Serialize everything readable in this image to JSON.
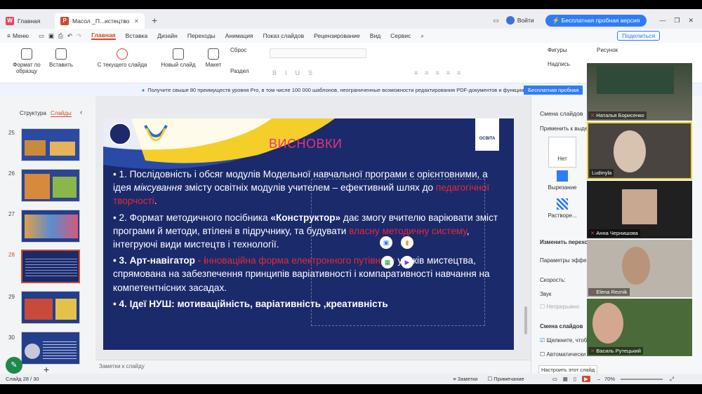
{
  "titlebar": {
    "home_tab": "Главная",
    "doc_tab": "Масол _П...истецтво",
    "add_tab": "+",
    "login": "Войти",
    "trial": "Бесплатная пробная версия"
  },
  "menubar": {
    "menu": "Меню",
    "items": [
      "Главная",
      "Вставка",
      "Дизайн",
      "Переходы",
      "Анимация",
      "Показ слайдов",
      "Рецензирование",
      "Вид",
      "Сервис"
    ],
    "share": "Поделиться"
  },
  "ribbon": {
    "format": "Формат по образцу",
    "insert": "Вставить",
    "from_current": "С текущего слайда",
    "new_slide": "Новый слайд",
    "layout": "Макет",
    "reset": "Сброс",
    "section": "Раздел",
    "shapes": "Фигуры",
    "picture": "Рисунок",
    "caption": "Надпись"
  },
  "promo": {
    "text": "Получите свыше 80 преимуществ уровня Pro, в том числе 100 000 шаблонов, неограниченные возможности редактирования PDF-документов и функции на основе ИИ.",
    "button": "Бесплатная пробная"
  },
  "leftpane": {
    "tab_structure": "Структура",
    "tab_slides": "Слайды",
    "slide_numbers": [
      "25",
      "26",
      "27",
      "28",
      "29",
      "30"
    ]
  },
  "slide": {
    "title": "ВИСНОВКИ",
    "logo_text": "ОСВІТА",
    "p1_a": "• 1. Послідовність і обсяг модулів Модельної навчальної програми є орієнтовними, а ідея ",
    "p1_b": "міксування",
    "p1_c": " змісту освітніх модулів учителем – ефективний шлях до ",
    "p1_d": "педагогічної творчості",
    "p1_e": ".",
    "p2_a": "• 2. Формат методичного посібника ",
    "p2_b": "«Конструктор»",
    "p2_c": " дає змогу вчителю варіювати зміст програми й методи, втілені в підручнику, та будувати ",
    "p2_d": "власну методичну систему",
    "p2_e": ", інтегруючі види мистецтв і технології.",
    "p3_a": "• 3. Арт-навігатор",
    "p3_b": " - і",
    "p3_c": "нноваційна форма електронного путівнику",
    "p3_d": " уроків мистецтва, спрямована на забезпечення принципів варіативності і компаративності навчання на компетентнісних засадах.",
    "p4": "• 4. Ідеї НУШ: мотиваційність, варіативність ,креативність"
  },
  "notes_placeholder": "Заметки к слайду",
  "rightpane": {
    "title": "Смена слайдов",
    "apply": "Применить к выдел",
    "none": "Нет",
    "cut": "Вырезание",
    "dissolve": "Растворе...",
    "modify": "Изменить переход",
    "params": "Параметры эффект",
    "speed": "Скорость:",
    "sound": "Звук",
    "loop": "Непрерывно",
    "change": "Смена слайдов",
    "on_click": "Щелкните, чтоб",
    "auto": "Автоматически",
    "apply_all": "Настроить этот слайд"
  },
  "status": {
    "slide": "Слайд 28 / 30",
    "notes": "Заметки",
    "comment": "Примечание",
    "zoom": "70%"
  },
  "participants": [
    "Наталья Борисенко",
    "Ludmyla",
    "Анна Чернишова",
    "Elena Reznik",
    "Василь Рутецький"
  ],
  "colors": {
    "accent": "#d04a2a",
    "slide_bg": "#1b2a6b",
    "title_pink": "#e8337a",
    "highlight_red": "#e5283a",
    "trial_blue": "#2f7cf6"
  }
}
